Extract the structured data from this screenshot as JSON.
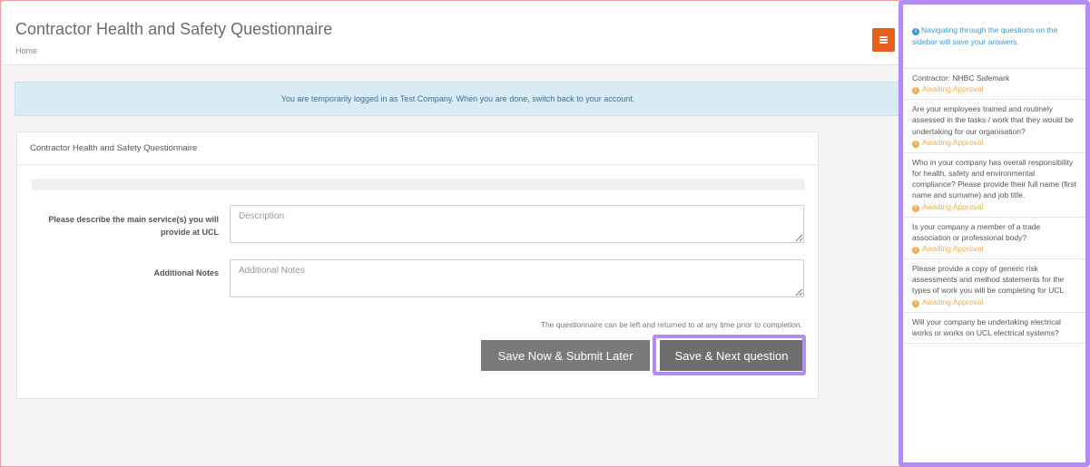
{
  "header": {
    "title": "Contractor Health and Safety Questionnaire",
    "breadcrumb": "Home",
    "menu_icon": "hamburger-menu-icon",
    "menu_color": "#e8601c"
  },
  "alert": {
    "text": "You are temporarily logged in as Test Company. When you are done, switch back to your account."
  },
  "panel": {
    "heading": "Contractor Health and Safety Questionnaire",
    "progress_percent": 0,
    "fields": [
      {
        "label": "Please describe the main service(s) you will provide at UCL",
        "placeholder": "Description",
        "value": ""
      },
      {
        "label": "Additional Notes",
        "placeholder": "Additional Notes",
        "value": ""
      }
    ],
    "help_text": "The questionnaire can be left and returned to at any time prior to completion.",
    "buttons": {
      "save_later": "Save Now & Submit Later",
      "save_next": "Save & Next question"
    }
  },
  "sidebar": {
    "notice": "Navigating through the questions on the sidebar will save your answers.",
    "items": [
      {
        "question": "Contractor: NHBC Safemark",
        "status": "Awaiting Approval"
      },
      {
        "question": "Are your employees trained and routinely assessed in the tasks / work that they would be undertaking for our organisation?",
        "status": "Awaiting Approval"
      },
      {
        "question": "Who in your company has overall responsibility for health, safety and environmental compliance? Please provide their full name (first name and surname) and job title.",
        "status": "Awaiting Approval"
      },
      {
        "question": "Is your company a member of a trade association or professional body?",
        "status": "Awaiting Approval"
      },
      {
        "question": "Please provide a copy of generic risk assessments and method statements for the types of work you will be completing for UCL",
        "status": "Awaiting Approval"
      },
      {
        "question": "Will your company be undertaking electrical works or works on UCL electrical systems?",
        "status": ""
      }
    ]
  },
  "colors": {
    "accent": "#e8601c",
    "highlight": "#b48cef",
    "alert_bg": "#d9ecf5",
    "status_warning": "#f0ad4e",
    "info": "#3b9ad4"
  }
}
